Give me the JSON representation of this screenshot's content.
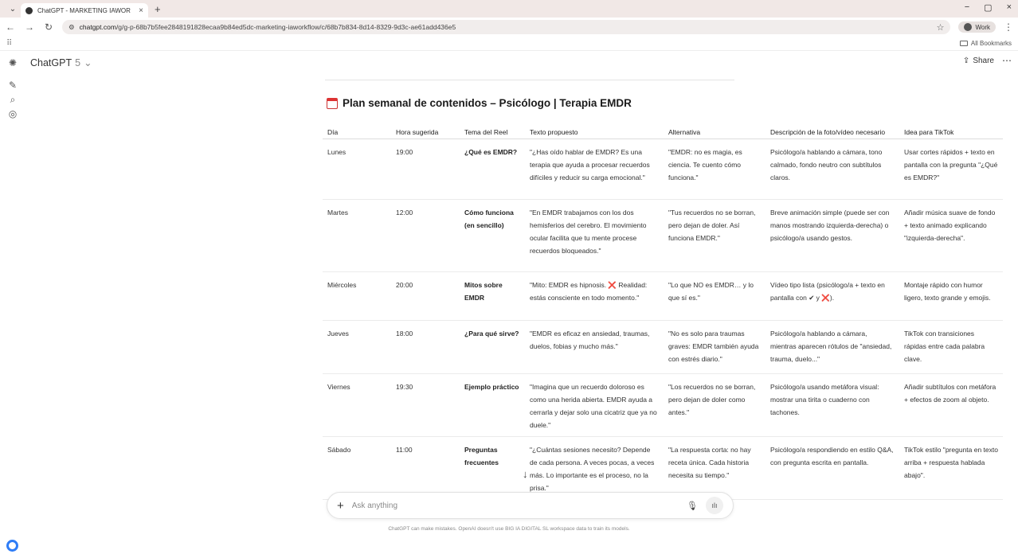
{
  "browser": {
    "tab_menu_icon": "chevron-down-icon",
    "tab_title": "ChatGPT - MARKETING IAWOR",
    "tab_close": "×",
    "new_tab": "+",
    "window_controls": [
      "−",
      "▢",
      "×"
    ],
    "url_domain": "chatgpt.com",
    "url_path": "/g/g-p-68b7b5fee2848191828ecaa9b84ed5dc-marketing-iaworkflow/c/68b7b834-8d14-8329-9d3c-ae61add436e5",
    "profile_label": "Work",
    "all_bookmarks": "All Bookmarks"
  },
  "app": {
    "model_name": "ChatGPT",
    "model_version": "5",
    "share_label": "Share"
  },
  "plan": {
    "title": "Plan semanal de contenidos – Psicólogo | Terapia EMDR",
    "headers": [
      "Día",
      "Hora sugerida",
      "Tema del Reel",
      "Texto propuesto",
      "Alternativa",
      "Descripción de la foto/vídeo necesario",
      "Idea para TikTok"
    ],
    "rows": [
      {
        "dia": "Lunes",
        "hora": "19:00",
        "tema": "¿Qué es EMDR?",
        "texto": "\"¿Has oído hablar de EMDR? Es una terapia que ayuda a procesar recuerdos difíciles y reducir su carga emocional.\"",
        "alternativa": "\"EMDR: no es magia, es ciencia. Te cuento cómo funciona.\"",
        "descripcion": "Psicólogo/a hablando a cámara, tono calmado, fondo neutro con subtítulos claros.",
        "tiktok": "Usar cortes rápidos + texto en pantalla con la pregunta \"¿Qué es EMDR?\""
      },
      {
        "dia": "Martes",
        "hora": "12:00",
        "tema": "Cómo funciona (en sencillo)",
        "texto": "\"En EMDR trabajamos con los dos hemisferios del cerebro. El movimiento ocular facilita que tu mente procese recuerdos bloqueados.\"",
        "alternativa": "\"Tus recuerdos no se borran, pero dejan de doler. Así funciona EMDR.\"",
        "descripcion": "Breve animación simple (puede ser con manos mostrando izquierda-derecha) o psicólogo/a usando gestos.",
        "tiktok": "Añadir música suave de fondo + texto animado explicando \"izquierda-derecha\"."
      },
      {
        "dia": "Miércoles",
        "hora": "20:00",
        "tema": "Mitos sobre EMDR",
        "texto": "\"Mito: EMDR es hipnosis. ❌ Realidad: estás consciente en todo momento.\"",
        "alternativa": "\"Lo que NO es EMDR… y lo que sí es.\"",
        "descripcion": "Vídeo tipo lista (psicólogo/a + texto en pantalla con ✔ y ❌).",
        "tiktok": "Montaje rápido con humor ligero, texto grande y emojis."
      },
      {
        "dia": "Jueves",
        "hora": "18:00",
        "tema": "¿Para qué sirve?",
        "texto": "\"EMDR es eficaz en ansiedad, traumas, duelos, fobias y mucho más.\"",
        "alternativa": "\"No es solo para traumas graves: EMDR también ayuda con estrés diario.\"",
        "descripcion": "Psicólogo/a hablando a cámara, mientras aparecen rótulos de \"ansiedad, trauma, duelo...\"",
        "tiktok": "TikTok con transiciones rápidas entre cada palabra clave."
      },
      {
        "dia": "Viernes",
        "hora": "19:30",
        "tema": "Ejemplo práctico",
        "texto": "\"Imagina que un recuerdo doloroso es como una herida abierta. EMDR ayuda a cerrarla y dejar solo una cicatriz que ya no duele.\"",
        "alternativa": "\"Los recuerdos no se borran, pero dejan de doler como antes.\"",
        "descripcion": "Psicólogo/a usando metáfora visual: mostrar una tirita o cuaderno con tachones.",
        "tiktok": "Añadir subtítulos con metáfora + efectos de zoom al objeto."
      },
      {
        "dia": "Sábado",
        "hora": "11:00",
        "tema": "Preguntas frecuentes",
        "texto": "\"¿Cuántas sesiones necesito? Depende de cada persona. A veces pocas, a veces más. Lo importante es el proceso, no la prisa.\"",
        "alternativa": "\"La respuesta corta: no hay receta única. Cada historia necesita su tiempo.\"",
        "descripcion": "Psicólogo/a respondiendo en estilo Q&A, con pregunta escrita en pantalla.",
        "tiktok": "TikTok estilo \"pregunta en texto arriba + respuesta hablada abajo\"."
      }
    ]
  },
  "composer": {
    "placeholder": "Ask anything"
  },
  "footer": {
    "disclaimer": "ChatGPT can make mistakes. OpenAI doesn't use BIG IA DIGITAL SL workspace data to train its models."
  }
}
